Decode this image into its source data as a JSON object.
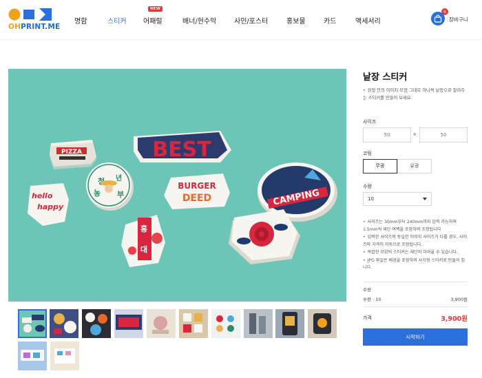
{
  "brand": {
    "logo_oh": "OH",
    "logo_rest": "PRINT.ME",
    "accent": "#2b6fdb",
    "orange": "#f2a11b",
    "red": "#e23b3b"
  },
  "nav": {
    "items": [
      "명함",
      "스티커",
      "어패럴",
      "배너/현수막",
      "사인/포스터",
      "홍보물",
      "카드",
      "액세서리"
    ],
    "active": "스티커",
    "new_badge": "NEW"
  },
  "cart": {
    "count": "4",
    "label": "장바구니",
    "icon": "shopping-bag-icon"
  },
  "main_image": {
    "sticker_texts": [
      "BEST",
      "PIZZA",
      "CAMPING",
      "BURGER",
      "DEED",
      "hello",
      "happy",
      "청",
      "년",
      "농",
      "부",
      "홍",
      "대"
    ]
  },
  "thumbnails": {
    "count": 12,
    "selected_index": 0
  },
  "product": {
    "title": "낱장 스티커",
    "description": "원형 안의 이미지 모양 그대로 하나씩 낱장으로 잘라주는 스티커를 만들어 보세요."
  },
  "options": {
    "size_label": "사이즈",
    "width": "50",
    "height": "50",
    "separator": "x",
    "coating_label": "코팅",
    "coating_options": [
      "무광",
      "유광"
    ],
    "coating_selected": "무광",
    "qty_label": "수량",
    "qty_value": "10"
  },
  "notes": [
    "사이즈는 30mm부터 240mm까지 입력 가능하며 1.5mm씩 재단 여백을 포함하여 조정됩니다.",
    "입력한 사이즈와 동일한 이미지 사이즈가 다를 경우, 사이즈와 가격이 자동으로 조정됩니다.",
    "복잡한 모양의 스티커는 재단이 어려울 수 있습니다.",
    "JPG 파일은 배경을 포함하여 사각형 스티커로 만들어 집니다."
  ],
  "summary": {
    "qty_title": "수량",
    "qty_line_label": "수량 : 10",
    "qty_line_price": "3,900원",
    "price_label": "가격",
    "price": "3,900원",
    "buy_label": "시작하기"
  }
}
